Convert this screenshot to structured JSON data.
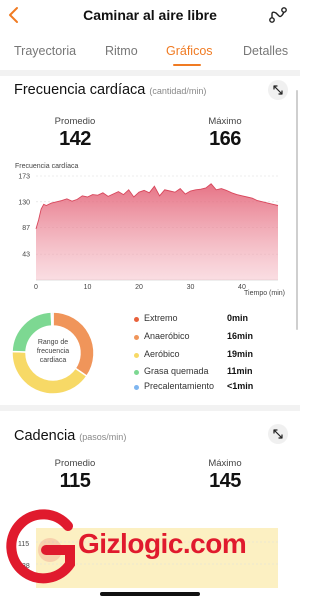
{
  "header": {
    "title": "Caminar al aire libre"
  },
  "tabs": [
    {
      "label": "Trayectoria",
      "active": false
    },
    {
      "label": "Ritmo",
      "active": false
    },
    {
      "label": "Gráficos",
      "active": true
    },
    {
      "label": "Detalles",
      "active": false
    }
  ],
  "heart": {
    "title": "Frecuencia cardíaca",
    "unit": "(cantidad/min)",
    "avg_label": "Promedio",
    "avg_value": "142",
    "max_label": "Máximo",
    "max_value": "166",
    "chart_title": "Frecuencia cardíaca",
    "x_label": "Tiempo (min)",
    "donut_label": "Rango de frecuencia cardiaca",
    "zones": [
      {
        "name": "Extremo",
        "time": "0min",
        "color": "#e8613b"
      },
      {
        "name": "Anaeróbico",
        "time": "16min",
        "color": "#f0955a"
      },
      {
        "name": "Aeróbico",
        "time": "19min",
        "color": "#f7d966"
      },
      {
        "name": "Grasa quemada",
        "time": "11min",
        "color": "#7dd892"
      },
      {
        "name": "Precalentamiento",
        "time": "<1min",
        "color": "#7fb6f0"
      }
    ]
  },
  "cadence": {
    "title": "Cadencia",
    "unit": "(pasos/min)",
    "avg_label": "Promedio",
    "avg_value": "115",
    "max_label": "Máximo",
    "max_value": "145",
    "y_ticks": [
      "115",
      "38"
    ]
  },
  "watermark": {
    "text": "Gizlogic",
    "suffix": ".com"
  },
  "chart_data": [
    {
      "type": "area",
      "title": "Frecuencia cardíaca",
      "xlabel": "Tiempo (min)",
      "ylabel": "",
      "x_ticks": [
        0,
        10,
        20,
        30,
        40
      ],
      "y_ticks": [
        43,
        87,
        130,
        173
      ],
      "xlim": [
        0,
        47
      ],
      "ylim": [
        0,
        173
      ],
      "grid": true,
      "color": "#e26a7c",
      "x": [
        0,
        0.5,
        1,
        1.5,
        2,
        3,
        4,
        5,
        6,
        7,
        8,
        9,
        10,
        11,
        12,
        13,
        14,
        15,
        16,
        17,
        18,
        19,
        20,
        21,
        22,
        23,
        24,
        25,
        26,
        27,
        28,
        29,
        30,
        31,
        32,
        33,
        34,
        35,
        36,
        37,
        38,
        39,
        40,
        41,
        42,
        43,
        44,
        45,
        46,
        47
      ],
      "y": [
        85,
        100,
        118,
        126,
        124,
        128,
        130,
        132,
        135,
        131,
        134,
        140,
        138,
        142,
        141,
        145,
        139,
        143,
        147,
        142,
        150,
        138,
        146,
        149,
        145,
        156,
        140,
        150,
        148,
        146,
        152,
        143,
        148,
        150,
        151,
        153,
        160,
        150,
        152,
        149,
        145,
        142,
        140,
        138,
        136,
        132,
        130,
        128,
        126,
        124
      ]
    },
    {
      "type": "pie",
      "title": "Rango de frecuencia cardiaca",
      "categories": [
        "Extremo",
        "Anaeróbico",
        "Aeróbico",
        "Grasa quemada",
        "Precalentamiento"
      ],
      "values": [
        0,
        16,
        19,
        11,
        0.3
      ],
      "colors": [
        "#e8613b",
        "#f0955a",
        "#f7d966",
        "#7dd892",
        "#7fb6f0"
      ]
    }
  ]
}
